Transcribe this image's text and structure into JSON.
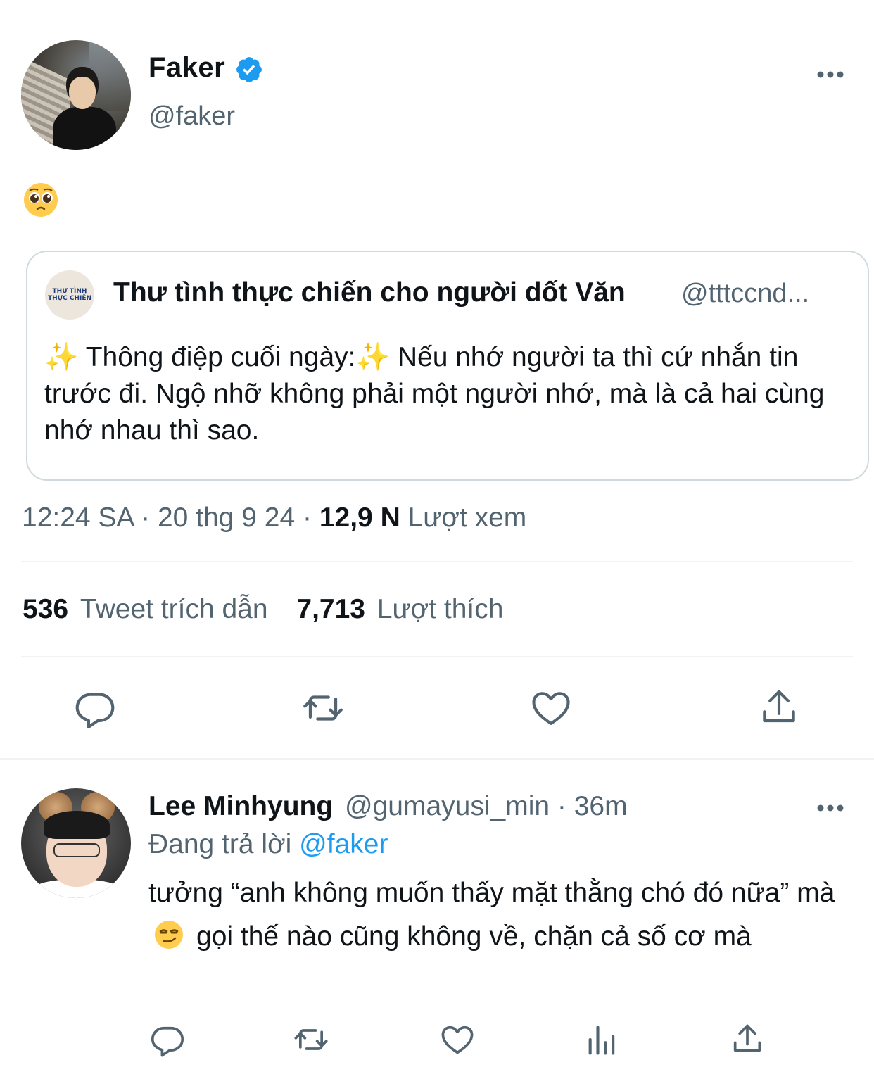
{
  "tweet": {
    "author_name": "Faker",
    "author_handle": "@faker",
    "verified": true,
    "body_emoji": "pleading-face-emoji",
    "quote": {
      "name": "Thư tình thực chiến cho người dốt Văn",
      "handle": "@tttccnd...",
      "avatar_text_line1": "THƯ TÌNH",
      "avatar_text_line2": "THỰC CHIẾN",
      "text_part1": "✨",
      "text_part2": " Thông điệp cuối ngày:",
      "text_part3": "✨",
      "text_part4": " Nếu nhớ người ta thì cứ nhắn tin trước đi. Ngộ nhỡ không phải một người nhớ, mà là cả hai cùng nhớ nhau thì sao."
    },
    "meta": {
      "time": "12:24 SA",
      "sep1": " · ",
      "date": "20 thg 9 24",
      "sep2": " · ",
      "views_count": "12,9 N",
      "views_label": " Lượt xem"
    },
    "stats": {
      "quotes_count": "536",
      "quotes_label": "Tweet trích dẫn",
      "likes_count": "7,713",
      "likes_label": "Lượt thích"
    },
    "actions": [
      "reply-icon",
      "retweet-icon",
      "like-icon",
      "share-icon"
    ]
  },
  "reply": {
    "author_name": "Lee Minhyung",
    "author_handle": "@gumayusi_min",
    "sep": " · ",
    "time": "36m",
    "replying_label": "Đang trả lời ",
    "replying_to": "@faker",
    "text_part1": "tưởng “anh không muốn thấy mặt thằng chó đó nữa” mà",
    "text_emoji": "smirking-face-emoji",
    "text_part2": "gọi thế nào cũng không về, chặn cả số cơ mà",
    "actions": [
      "reply-icon",
      "retweet-icon",
      "like-icon",
      "views-icon",
      "share-icon"
    ]
  },
  "colors": {
    "text_primary": "#0f1419",
    "text_secondary": "#536471",
    "accent": "#1d9bf0",
    "border": "#cfd9de"
  }
}
